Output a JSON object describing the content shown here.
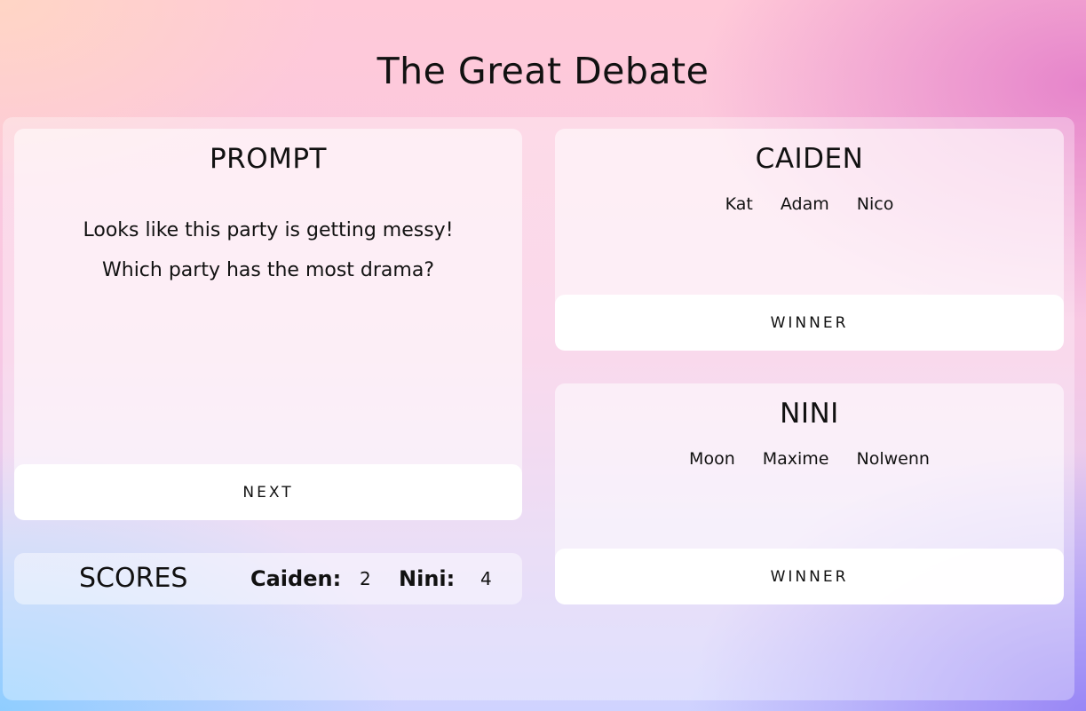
{
  "page": {
    "title": "The Great Debate"
  },
  "prompt_card": {
    "heading": "PROMPT",
    "lines": [
      "Looks like this party is getting messy!",
      "Which party has the most drama?"
    ],
    "next_label": "NEXT"
  },
  "teams": [
    {
      "name": "CAIDEN",
      "members": [
        "Kat",
        "Adam",
        "Nico"
      ],
      "winner_label": "WINNER"
    },
    {
      "name": "NINI",
      "members": [
        "Moon",
        "Maxime",
        "Nolwenn"
      ],
      "winner_label": "WINNER"
    }
  ],
  "scores": {
    "label": "SCORES",
    "entries": [
      {
        "name": "Caiden:",
        "value": "2"
      },
      {
        "name": "Nini:",
        "value": "4"
      }
    ]
  }
}
